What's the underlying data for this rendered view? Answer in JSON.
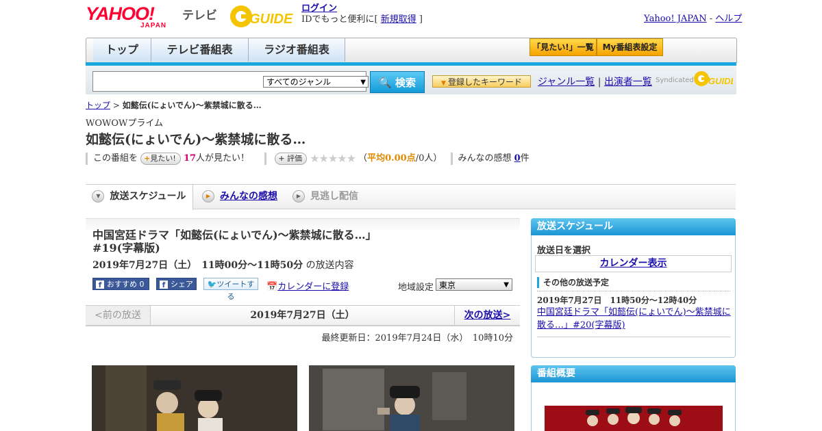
{
  "header": {
    "logo_text": "YAHOO!",
    "logo_sub": "JAPAN",
    "tv_label": "テレビ",
    "gguide_text": "GUIDE",
    "login_label": "ログイン",
    "login_note_prefix": "IDでもっと便利に[ ",
    "register_label": "新規取得",
    "login_note_suffix": " ]",
    "yahoo_japan_link": "Yahoo! JAPAN",
    "help_sep": " - ",
    "help_link": "ヘルプ"
  },
  "nav": {
    "tabs": [
      "トップ",
      "テレビ番組表",
      "ラジオ番組表"
    ],
    "want_list_btn": "「見たい!」一覧",
    "my_schedule_btn": "My番組表設定"
  },
  "search": {
    "input_value": "",
    "genre_selected": "すべてのジャンル",
    "search_btn": "検索",
    "keyword_btn": "登録したキーワード",
    "genre_list_link": "ジャンル一覧",
    "link_sep": " | ",
    "performer_list_link": "出演者一覧",
    "syndicated_label": "Syndicated"
  },
  "breadcrumb": {
    "top": "トップ",
    "sep": " > ",
    "current": "如懿伝(にょいでん)～紫禁城に散る…"
  },
  "program": {
    "channel": "WOWOWプライム",
    "title": "如懿伝(にょいでん)～紫禁城に散る…",
    "want_prefix": "この番組を",
    "want_btn": "見たい!",
    "want_count": "17",
    "want_suffix": "人が見たい！",
    "rate_btn": "評価",
    "stars": "★★★★★",
    "avg_open": "（",
    "avg_label": "平均0.00点",
    "avg_rest": "/0人）",
    "impressions_label": "みんなの感想 ",
    "impressions_count": "0",
    "impressions_unit": "件"
  },
  "tabs": {
    "schedule": "放送スケジュール",
    "impressions": "みんなの感想",
    "vod": "見逃し配信"
  },
  "episode": {
    "title": "中国宮廷ドラマ「如懿伝(にょいでん)～紫禁城に散る…」#19(字幕版)",
    "datetime": "2019年7月27日（土）　11時00分～11時50分",
    "datetime_suffix": " の放送内容",
    "fb_recommend": "おすすめ 0",
    "fb_share": "シェア",
    "tweet": "ツイートする",
    "calendar_register": "カレンダーに登録",
    "region_label": "地域設定",
    "region_value": "東京"
  },
  "pager": {
    "prev": "<前の放送",
    "date": "2019年7月27日（土）",
    "next": "次の放送>"
  },
  "updated": "最終更新日：2019年7月24日（水）　10時10分",
  "sidebar": {
    "schedule_head": "放送スケジュール",
    "select_date": "放送日を選択",
    "calendar_link": "カレンダー表示",
    "other_head": "その他の放送予定",
    "other_time": "2019年7月27日　11時50分～12時40分",
    "other_link": "中国宮廷ドラマ「如懿伝(にょいでん)～紫禁城に散る…」#20(字幕版)",
    "summary_head": "番組概要"
  },
  "colors": {
    "accent_blue": "#19a7df",
    "yahoo_red": "#ff0033",
    "link": "#1a0dab",
    "orange": "#e08a00"
  }
}
